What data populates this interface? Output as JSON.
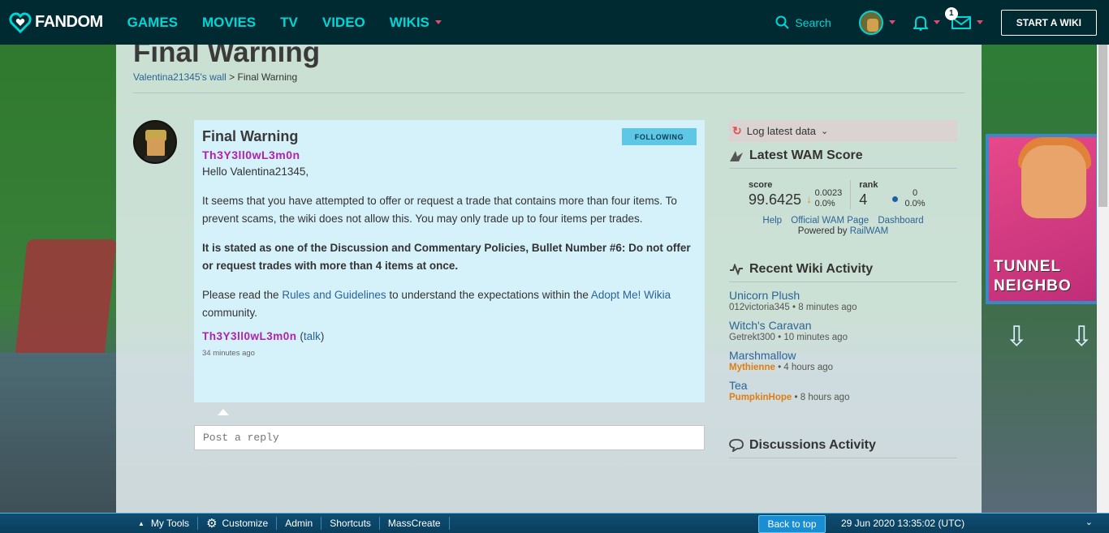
{
  "nav": {
    "logo": "FANDOM",
    "links": [
      "GAMES",
      "MOVIES",
      "TV",
      "VIDEO",
      "WIKIS"
    ],
    "search": "Search",
    "notification_count": "1",
    "start_wiki": "START A WIKI"
  },
  "background": {
    "poster_text": "TUNNEL NEIGHBO"
  },
  "page": {
    "title": "Final Warning",
    "breadcrumb_link": "Valentina21345's wall",
    "breadcrumb_sep": ">",
    "breadcrumb_current": "Final Warning"
  },
  "message": {
    "title": "Final Warning",
    "follow_label": "FOLLOWING",
    "author": "Th3Y3ll0wL3m0n",
    "greeting": "Hello Valentina21345,",
    "para1": "It seems that you have attempted to offer or request a trade that contains more than four items. To prevent scams, the wiki does not allow this. You may only trade up to four items per trades.",
    "para2": "It is stated as one of the Discussion and Commentary Policies, Bullet Number #6: Do not offer or request trades with more than 4 items at once.",
    "para3_a": "Please read the ",
    "para3_link1": "Rules and Guidelines",
    "para3_b": " to understand the expectations within the ",
    "para3_link2": "Adopt Me! Wikia",
    "para3_c": " community.",
    "sig_user": "Th3Y3ll0wL3m0n",
    "sig_talk": "talk",
    "timestamp": "34 minutes ago",
    "reply_placeholder": "Post a reply"
  },
  "rail": {
    "log_label": "Log latest data",
    "wam_heading": "Latest WAM Score",
    "score_label": "score",
    "score_value": "99.6425",
    "score_delta": "0.0023",
    "score_pct": "0.0%",
    "rank_label": "rank",
    "rank_value": "4",
    "rank_delta": "0",
    "rank_pct": "0.0%",
    "links": [
      "Help",
      "Official WAM Page",
      "Dashboard"
    ],
    "powered_prefix": "Powered by ",
    "powered_link": "RailWAM",
    "activity_heading": "Recent Wiki Activity",
    "activity": [
      {
        "title": "Unicorn Plush",
        "user": "012victoria345",
        "time": " • 8 minutes ago",
        "highlight": false
      },
      {
        "title": "Witch's Caravan",
        "user": "Getrekt300",
        "time": " • 10 minutes ago",
        "highlight": false
      },
      {
        "title": "Marshmallow",
        "user": "Mythienne",
        "time": " • 4 hours ago",
        "highlight": true
      },
      {
        "title": "Tea",
        "user": "PumpkinHope",
        "time": " • 8 hours ago",
        "highlight": true
      }
    ],
    "discussions_heading": "Discussions Activity"
  },
  "toolbar": {
    "items": [
      "My Tools",
      "Customize",
      "Admin",
      "Shortcuts",
      "MassCreate"
    ],
    "back_to_top": "Back to top",
    "datetime": "29 Jun 2020 13:35:02 (UTC)"
  },
  "colors": {
    "nav_bg": "#002a32",
    "accent": "#00d6d6",
    "username": "#b021b0",
    "link": "#2a6496"
  }
}
